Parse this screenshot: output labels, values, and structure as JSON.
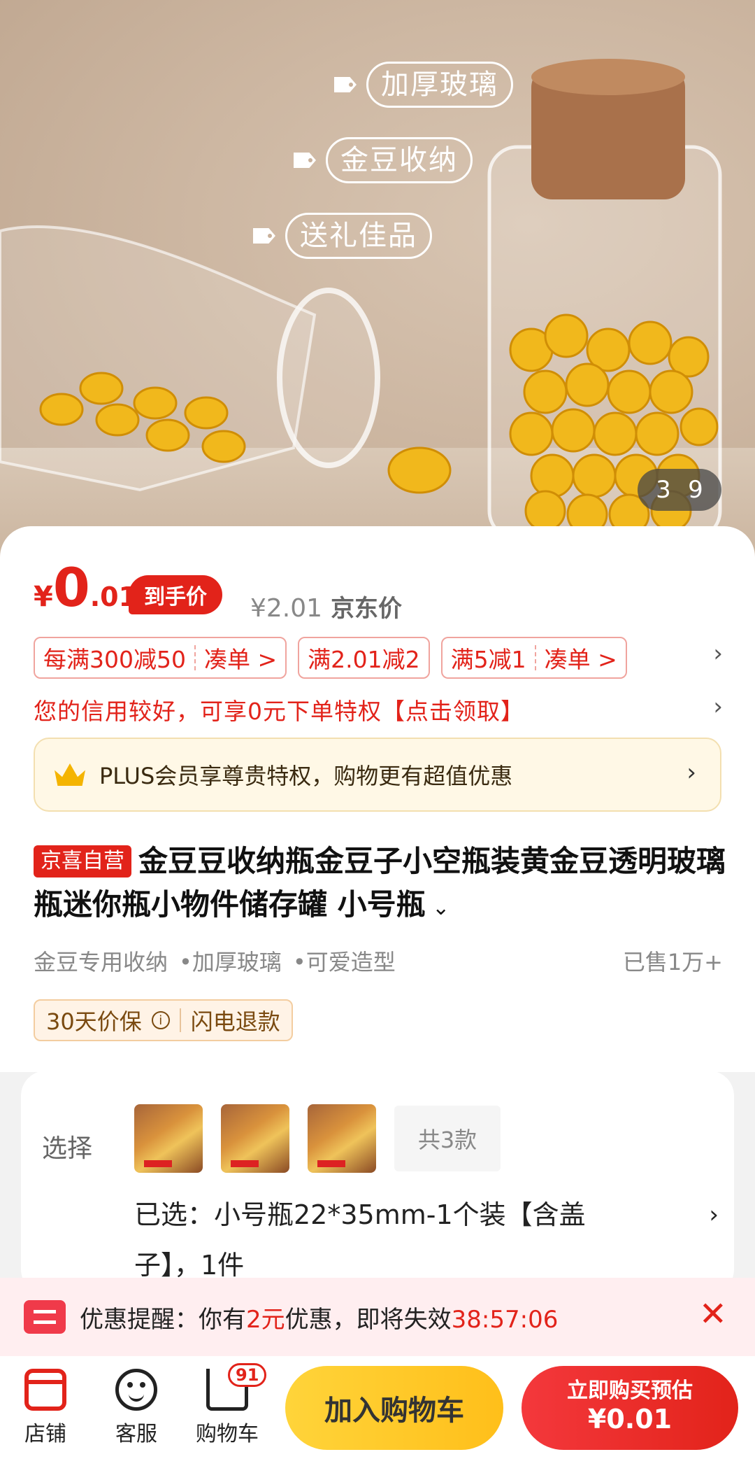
{
  "hero": {
    "tags": [
      "加厚玻璃",
      "金豆收纳",
      "送礼佳品"
    ],
    "counter_current": "3",
    "counter_total": "9"
  },
  "price": {
    "yen": "¥",
    "int": "0",
    "dec": ".01",
    "daoshou_label": "到手价",
    "jd_price": "¥2.01",
    "jd_label": "京东价"
  },
  "promos": [
    {
      "main": "每满300减50",
      "extra": "凑单 >"
    },
    {
      "main": "满2.01减2",
      "extra": ""
    },
    {
      "main": "满5减1",
      "extra": "凑单 >"
    }
  ],
  "credit_text": "您的信用较好，可享0元下单特权【点击领取】",
  "plus_text": "PLUS会员享尊贵特权，购物更有超值优惠",
  "product": {
    "self_tag": "京喜自营",
    "title": "金豆豆收纳瓶金豆子小空瓶装黄金豆透明玻璃瓶迷你瓶小物件储存罐 小号瓶",
    "features": [
      "金豆专用收纳",
      "•加厚玻璃",
      "•可爱造型"
    ],
    "sold": "已售1万+",
    "guarantee_1": "30天价保",
    "guarantee_2": "闪电退款"
  },
  "select": {
    "label": "选择",
    "total": "共3款",
    "selected": "已选：小号瓶22*35mm-1个装【含盖子】，1件"
  },
  "reminder": {
    "prefix": "优惠提醒：你有",
    "amount": "2元",
    "suffix": "优惠，即将失效",
    "countdown": "38:57:06"
  },
  "bottom": {
    "store": "店铺",
    "service": "客服",
    "cart": "购物车",
    "cart_badge": "91",
    "add_cart": "加入购物车",
    "buy_line1": "立即购买预估",
    "buy_line2": "¥0.01"
  }
}
